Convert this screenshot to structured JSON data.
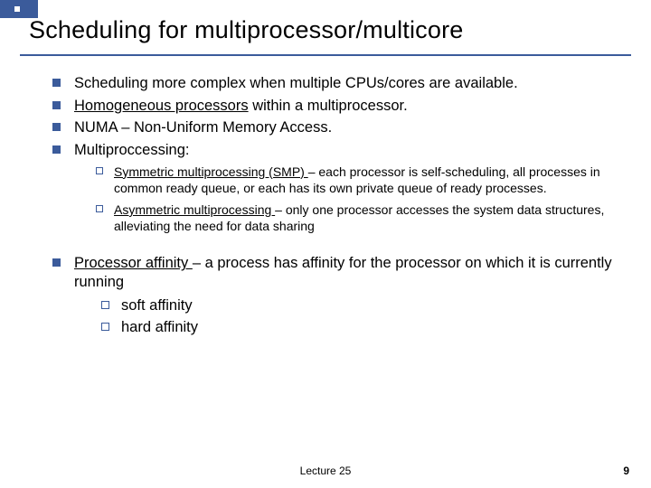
{
  "title": "Scheduling for multiprocessor/multicore",
  "bullets": {
    "b0": "Scheduling more complex when multiple CPUs/cores are available.",
    "b1_u": "Homogeneous processors",
    "b1_rest": " within a multiprocessor.",
    "b2": "NUMA – Non-Uniform Memory Access.",
    "b3": "Multiproccessing:",
    "s0_u": "Symmetric multiprocessing  (SMP) ",
    "s0_rest": "– each processor is self-scheduling, all processes in common ready queue, or each has its own private queue of ready processes.",
    "s1_u": "Asymmetric multiprocessing ",
    "s1_rest": "– only one processor accesses the system data structures, alleviating the need for data sharing",
    "b4_u": "Processor affinity ",
    "b4_rest": "– a process has affinity for the processor on which it is currently running",
    "a0": "soft affinity",
    "a1": "hard affinity"
  },
  "footer": "Lecture 25",
  "page": "9"
}
